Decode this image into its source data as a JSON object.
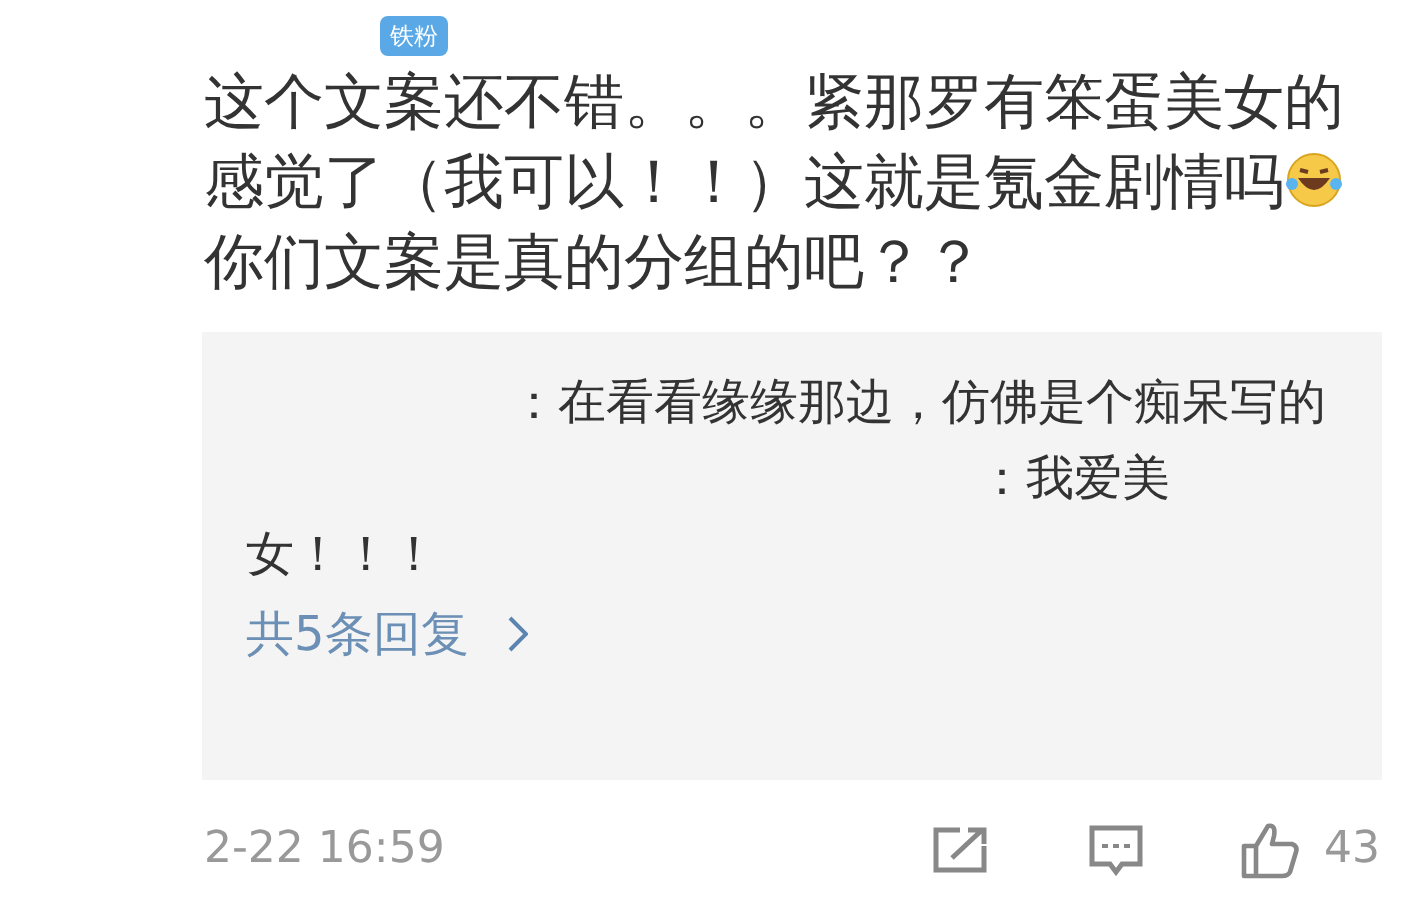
{
  "badge": "铁粉",
  "comment": {
    "text_before_emoji": "这个文案还不错。。。紧那罗有笨蛋美女的感觉了（我可以！！）这就是氪金剧情吗",
    "text_after_emoji": "你们文案是真的分组的吧？？"
  },
  "replies": [
    {
      "text": "：在看看缘缘那边，仿佛是个痴呆写的"
    },
    {
      "text": "：我爱美女！！！"
    }
  ],
  "more_replies": "共5条回复",
  "footer": {
    "time": "2-22 16:59",
    "likes": "43"
  }
}
